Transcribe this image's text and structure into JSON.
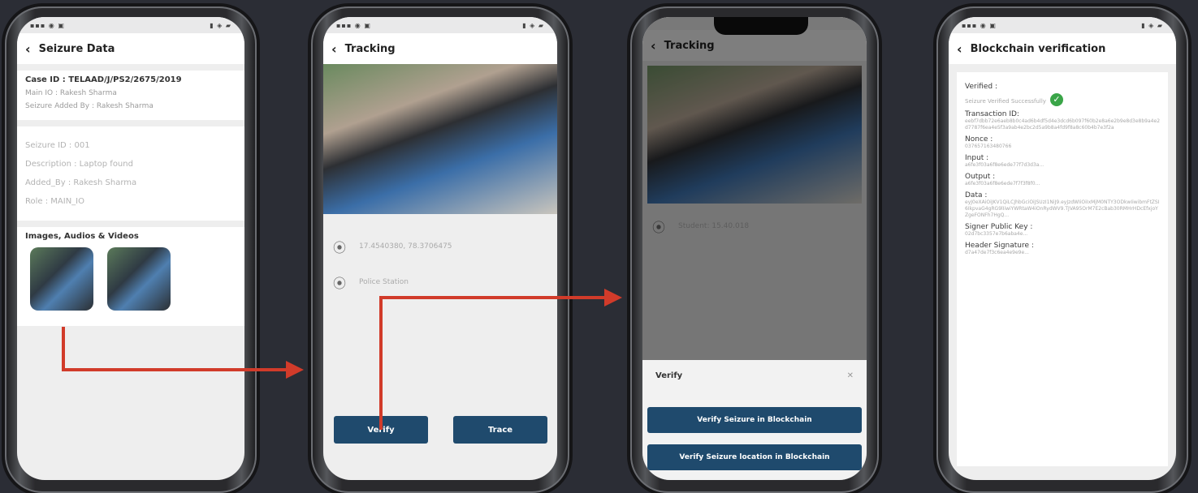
{
  "colors": {
    "arrow": "#d13b2a",
    "button": "#1f4a6d",
    "background": "#2b2d35",
    "verified": "#3aa548"
  },
  "screen1": {
    "title": "Seizure Data",
    "case_id": "Case ID : TELAAD/J/PS2/2675/2019",
    "main_io": "Main IO : Rakesh Sharma",
    "seizure_added_by": "Seizure Added By : Rakesh Sharma",
    "seizure_id": "Seizure ID : 001",
    "description": "Description : Laptop found",
    "added_by": "Added_By : Rakesh Sharma",
    "role": "Role : MAIN_IO",
    "media_heading": "Images, Audios & Videos"
  },
  "screen2": {
    "title": "Tracking",
    "coords": "17.4540380, 78.3706475",
    "place": "Police Station",
    "verify_label": "Verify",
    "trace_label": "Trace"
  },
  "screen3": {
    "title": "Tracking",
    "location": "Student: 15.40.018",
    "sheet_title": "Verify",
    "btn_seizure": "Verify Seizure in Blockchain",
    "btn_location": "Verify Seizure location in Blockchain"
  },
  "screen4": {
    "title": "Blockchain verification",
    "verified_label": "Verified :",
    "verified_value": "Seizure Verified Successfully",
    "transaction_label": "Transaction ID:",
    "transaction_value": "eebf7dbb72e6aeb8b0c4ad6b4df5d4e3dcd6b097f60b2e8a6e2b9e8d3e8b9a4e2d7787f6ea4e5f3a9ab4e2bc2d5a9b8a4fd9f8a8c60b4b7e3f2a",
    "nonce_label": "Nonce :",
    "nonce_value": "037657163480766",
    "input_label": "Input :",
    "input_value": "a6fe3f03a6f8e6ede77f7d3d3a...",
    "output_label": "Output :",
    "output_value": "a6fe3f03a6f8e6ede7f7f3f8f0...",
    "data_label": "Data :",
    "data_value": "eyJ0eXAiOiJKV1QiLCJhbGciOiJSUzI1NiJ9.eyJzdWIiOiIxMjM0NTY3ODkwIiwibmFtZSI6IkpvaG4gRG9lIiwiYWRtaW4iOnRydWV9.TJVA95OrM7E2cBab30RMHrHDcEfxjoYZgeFONFh7HgQ...",
    "signer_label": "Signer Public Key :",
    "signer_value": "02d7bc3357e7b6aba4e...",
    "header_label": "Header Signature :",
    "header_value": "d7a47de7f3c6ea4e9e9e..."
  }
}
